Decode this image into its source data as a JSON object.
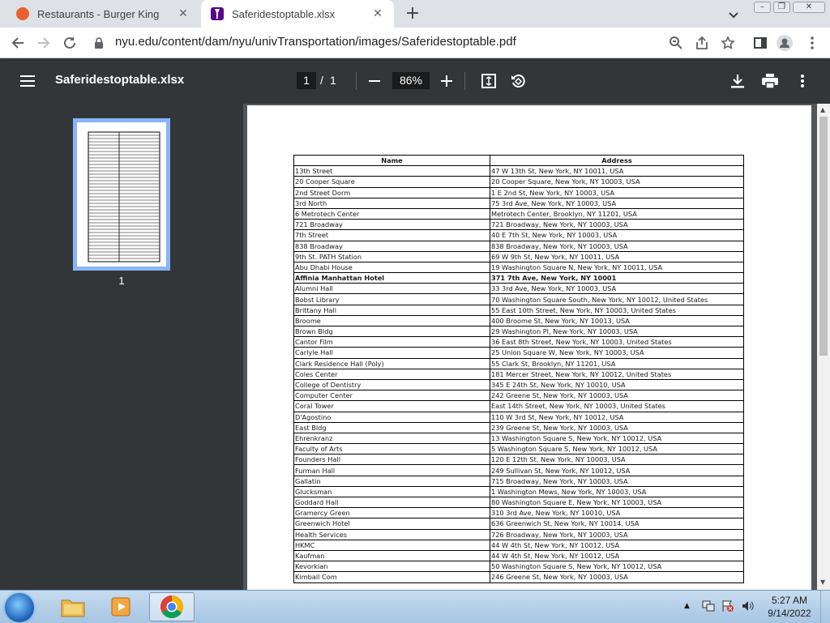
{
  "browser": {
    "tabs": [
      {
        "title": "Restaurants - Burger King",
        "favicon": "burger-king-logo",
        "active": false
      },
      {
        "title": "Saferidestoptable.xlsx",
        "favicon": "nyu-torch-logo",
        "active": true
      }
    ],
    "new_tab_label": "+",
    "url": "nyu.edu/content/dam/nyu/univTransportation/images/Saferidestoptable.pdf"
  },
  "pdf": {
    "title": "Saferidestoptable.xlsx",
    "current_page": "1",
    "page_separator": "/",
    "total_pages": "1",
    "zoom": "86%",
    "thumbnail_label": "1"
  },
  "table": {
    "headers": [
      "Name",
      "Address"
    ],
    "rows": [
      [
        "13th Street",
        "47 W 13th St, New York, NY 10011, USA"
      ],
      [
        "20 Cooper Square",
        "20 Cooper Square, New York, NY 10003, USA"
      ],
      [
        "2nd Street Dorm",
        "1 E 2nd St, New York, NY 10003, USA"
      ],
      [
        "3rd North",
        "75 3rd Ave, New York, NY 10003, USA"
      ],
      [
        "6 Metrotech Center",
        "Metrotech Center, Brooklyn, NY 11201, USA"
      ],
      [
        "721 Broadway",
        "721 Broadway, New York, NY 10003, USA"
      ],
      [
        "7th Street",
        "40 E 7th St, New York, NY 10003, USA"
      ],
      [
        "838 Broadway",
        "838 Broadway, New York, NY 10003, USA"
      ],
      [
        "9th St. PATH Station",
        "69 W 9th St, New York, NY 10011, USA"
      ],
      [
        "Abu Dhabi House",
        "19 Washington Square N, New York, NY 10011, USA"
      ],
      [
        "Affinia Manhattan Hotel",
        "371 7th Ave, New York, NY 10001"
      ],
      [
        "Alumni Hall",
        "33 3rd Ave, New York, NY 10003, USA"
      ],
      [
        "Bobst Library",
        "70 Washington Square South, New York, NY 10012, United States"
      ],
      [
        "Brittany Hall",
        "55 East 10th Street, New York, NY 10003, United States"
      ],
      [
        "Broome",
        "400 Broome St, New York, NY 10013, USA"
      ],
      [
        "Brown Bldg",
        "29 Washington Pl, New York, NY 10003, USA"
      ],
      [
        "Cantor Film",
        "36 East 8th Street, New York, NY 10003, United States"
      ],
      [
        "Carlyle Hall",
        "25 Union Square W, New York, NY 10003, USA"
      ],
      [
        "Clark Residence Hall (Poly)",
        "55 Clark St, Brooklyn, NY 11201, USA"
      ],
      [
        "Coles Center",
        "181 Mercer Street, New York, NY 10012, United States"
      ],
      [
        "College of Dentistry",
        "345 E 24th St, New York, NY 10010, USA"
      ],
      [
        "Computer Center",
        "242 Greene St, New York, NY 10003, USA"
      ],
      [
        "Coral Tower",
        "East 14th Street, New York, NY 10003, United States"
      ],
      [
        "D'Agostino",
        "110 W 3rd St, New York, NY 10012, USA"
      ],
      [
        "East Bldg",
        "239 Greene St, New York, NY 10003, USA"
      ],
      [
        "Ehrenkranz",
        "13 Washington Square S, New York, NY 10012, USA"
      ],
      [
        "Faculty of Arts",
        "5 Washington Square S, New York, NY 10012, USA"
      ],
      [
        "Founders Hall",
        "120 E 12th St, New York, NY 10003, USA"
      ],
      [
        "Furman Hall",
        "249 Sullivan St, New York, NY 10012, USA"
      ],
      [
        "Gallatin",
        "715 Broadway, New York, NY 10003, USA"
      ],
      [
        "Glucksman",
        "1 Washington Mews, New York, NY 10003, USA"
      ],
      [
        "Goddard Hall",
        "80 Washington Square E, New York, NY 10003, USA"
      ],
      [
        "Gramercy Green",
        "310 3rd Ave, New York, NY 10010, USA"
      ],
      [
        "Greenwich Hotel",
        "636 Greenwich St, New York, NY 10014, USA"
      ],
      [
        "Health Services",
        "726 Broadway, New York, NY 10003, USA"
      ],
      [
        "HKMC",
        "44 W 4th St, New York, NY 10012, USA"
      ],
      [
        "Kaufman",
        "44 W 4th St, New York, NY 10012, USA"
      ],
      [
        "Kevorkian",
        "50 Washington Square S, New York, NY 10012, USA"
      ],
      [
        "Kimball Com",
        "246 Greene St, New York, NY 10003, USA"
      ]
    ],
    "bold_row_index": 10
  },
  "taskbar": {
    "time": "5:27 AM",
    "date": "9/14/2022"
  }
}
